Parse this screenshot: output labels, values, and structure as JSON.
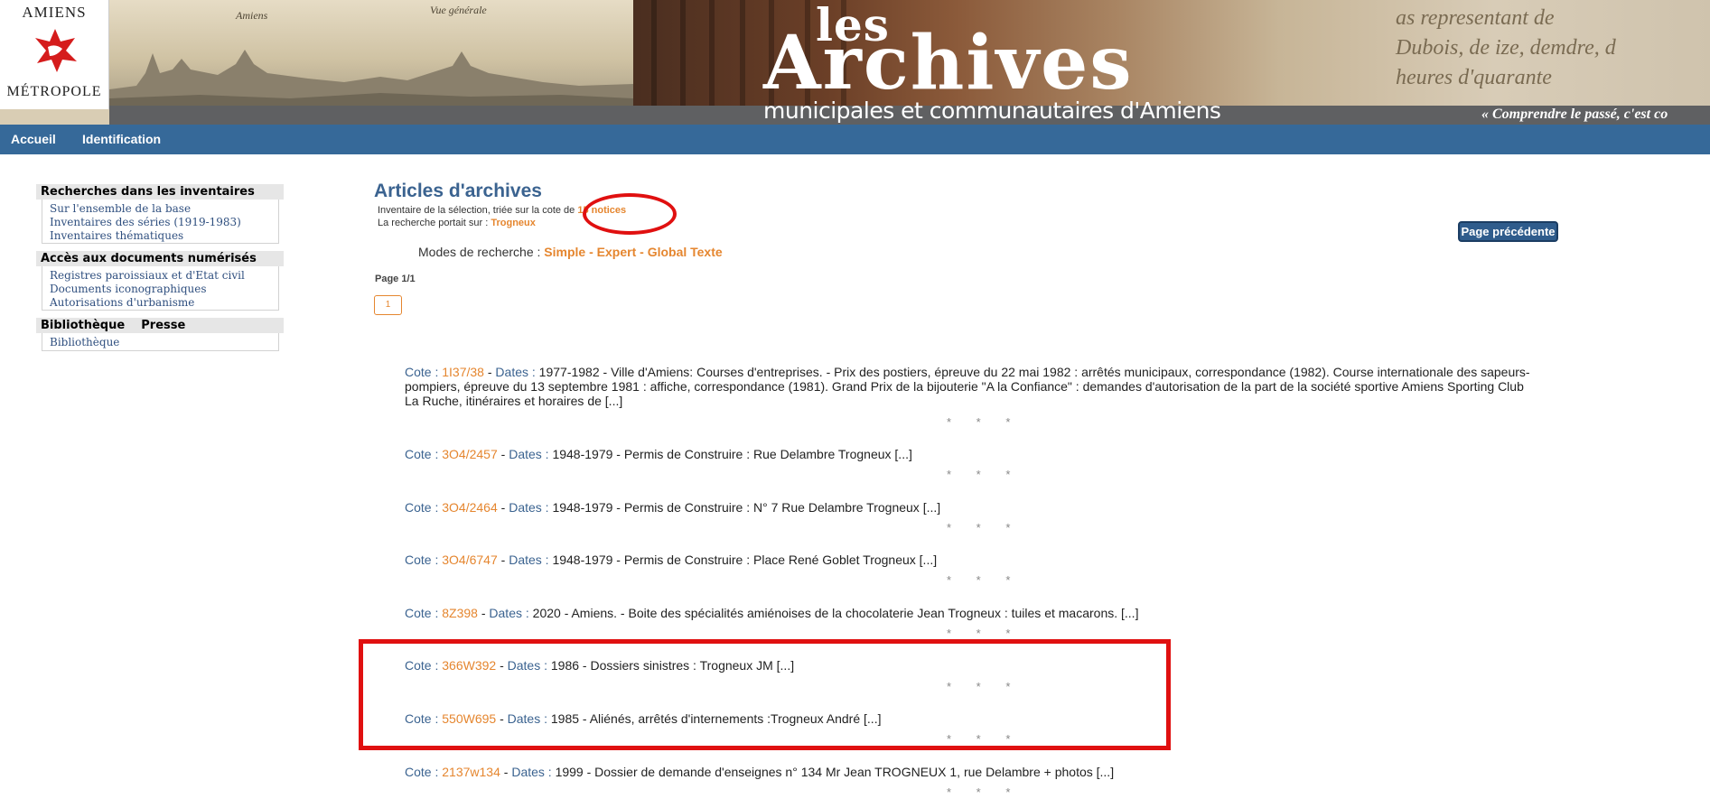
{
  "banner": {
    "logo_top": "AMIENS",
    "logo_bottom": "MÉTROPOLE",
    "photo_caption_1": "Amiens",
    "photo_caption_2": "Vue générale",
    "title_small": "les",
    "title_main": "Archives",
    "title_sub": "municipales et communautaires d'Amiens",
    "motto": "« Comprendre le passé, c'est co"
  },
  "nav": {
    "items": [
      "Accueil",
      "Identification"
    ]
  },
  "sidebar": {
    "sections": [
      {
        "title": "Recherches dans les inventaires",
        "links": [
          "Sur l'ensemble de la base",
          "Inventaires des séries (1919-1983)",
          "Inventaires thématiques"
        ]
      },
      {
        "title": "Accès aux documents numérisés",
        "links": [
          "Registres paroissiaux et d'Etat civil",
          "Documents iconographiques",
          "Autorisations d'urbanisme"
        ]
      },
      {
        "title": "Bibliothèque    Presse",
        "links": [
          "Bibliothèque"
        ]
      }
    ]
  },
  "main": {
    "title": "Articles d'archives",
    "selection_text": "Inventaire de la sélection, triée sur la cote de",
    "notices_count": "15 notices",
    "search_text": "La recherche portait sur :",
    "search_term": "Trogneux",
    "modes_label": "Modes de recherche :",
    "modes": [
      "Simple",
      "Expert",
      "Global Texte"
    ],
    "mode_separator": "-",
    "page_label": "Page 1/1",
    "page_button": "1",
    "prev_button": "Page précédente",
    "cote_label": "Cote :",
    "dates_label": "Dates :",
    "separator": "* * *",
    "records": [
      {
        "cote": "1I37/38",
        "text": "1977-1982 - Ville d'Amiens: Courses d'entreprises. - Prix des postiers, épreuve du 22 mai 1982 : arrêtés municipaux, correspondance (1982). Course internationale des sapeurs-pompiers, épreuve du 13 septembre 1981 : affiche, correspondance (1981). Grand Prix de la bijouterie \"A la Confiance\" : demandes d'autorisation de la part de la société sportive Amiens Sporting Club La Ruche, itinéraires et horaires de [...]"
      },
      {
        "cote": "3O4/2457",
        "text": "1948-1979 - Permis de Construire : Rue Delambre Trogneux [...]"
      },
      {
        "cote": "3O4/2464",
        "text": "1948-1979 - Permis de Construire : N° 7 Rue Delambre Trogneux [...]"
      },
      {
        "cote": "3O4/6747",
        "text": "1948-1979 - Permis de Construire : Place René Goblet Trogneux [...]"
      },
      {
        "cote": "8Z398",
        "text": "2020 - Amiens. - Boite des spécialités amiénoises de la chocolaterie Jean Trogneux : tuiles et macarons. [...]"
      },
      {
        "cote": "366W392",
        "text": "1986 - Dossiers sinistres : Trogneux JM [...]"
      },
      {
        "cote": "550W695",
        "text": "1985 - Aliénés, arrêtés d'internements :Trogneux André [...]"
      },
      {
        "cote": "2137w134",
        "text": "1999 - Dossier de demande d'enseignes n° 134 Mr Jean TROGNEUX 1, rue Delambre + photos [...]"
      }
    ]
  },
  "colors": {
    "nav": "#366999",
    "accent": "#e5862f",
    "title": "#3b6390",
    "annotation": "#e01010"
  }
}
